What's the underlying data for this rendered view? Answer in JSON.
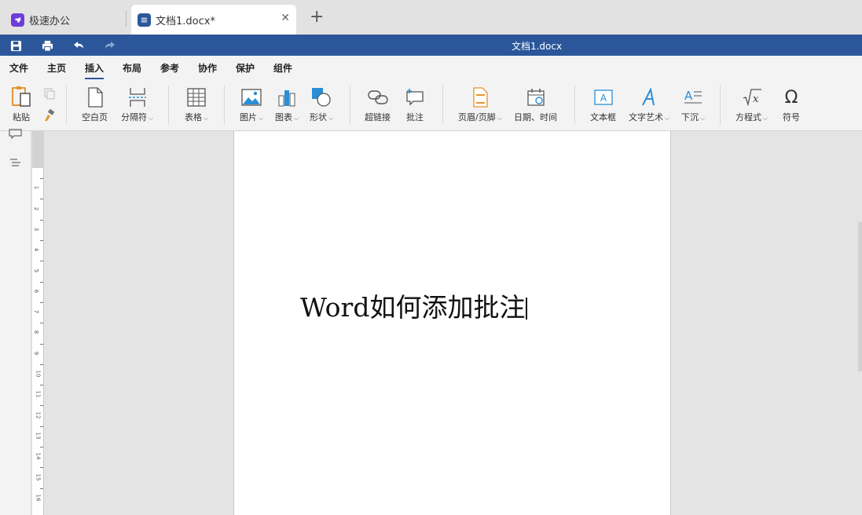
{
  "tabs": [
    {
      "label": "极速办公",
      "active": false
    },
    {
      "label": "文档1.docx*",
      "active": true
    }
  ],
  "new_tab_label": "+",
  "close_glyph": "✕",
  "title": "文档1.docx",
  "menu": [
    "文件",
    "主页",
    "插入",
    "布局",
    "参考",
    "协作",
    "保护",
    "组件"
  ],
  "active_menu": "插入",
  "ribbon": {
    "paste": "粘贴",
    "blank_page": "空白页",
    "page_break": "分隔符",
    "table": "表格",
    "picture": "图片",
    "chart": "图表",
    "shape": "形状",
    "hyperlink": "超链接",
    "comment": "批注",
    "header_footer": "页眉/页脚",
    "datetime": "日期、时间",
    "textbox": "文本框",
    "wordart": "文字艺术",
    "dropcap": "下沉",
    "equation": "方程式",
    "symbol": "符号"
  },
  "document": {
    "text": "Word如何添加批注"
  },
  "ruler_numbers": [
    "1",
    "2",
    "3",
    "4",
    "5",
    "6",
    "7",
    "8",
    "9",
    "10",
    "11",
    "12",
    "13",
    "14",
    "15",
    "16"
  ],
  "colors": {
    "title_bar": "#2b579a",
    "accent": "#2b579a",
    "app_icon": "#6c3ed6",
    "doc_icon": "#2b579a"
  }
}
